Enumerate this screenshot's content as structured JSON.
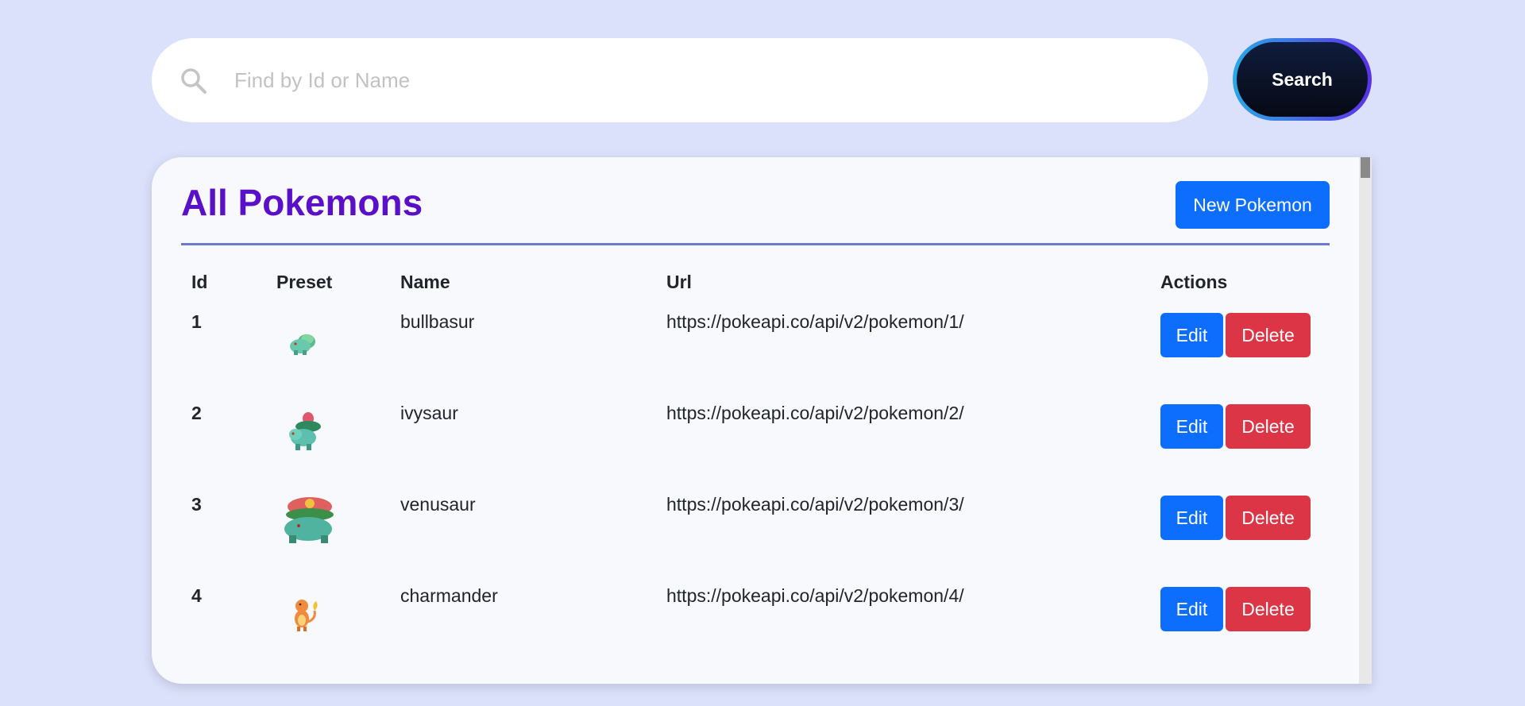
{
  "search": {
    "placeholder": "Find by Id or Name",
    "button_label": "Search",
    "icon": "search-icon"
  },
  "card": {
    "title": "All Pokemons",
    "new_button_label": "New Pokemon"
  },
  "table": {
    "headers": [
      "Id",
      "Preset",
      "Name",
      "Url",
      "Actions"
    ],
    "rows": [
      {
        "id": "1",
        "preset": "bulbasaur-sprite",
        "name": "bullbasur",
        "url": "https://pokeapi.co/api/v2/pokemon/1/",
        "edit": "Edit",
        "delete": "Delete"
      },
      {
        "id": "2",
        "preset": "ivysaur-sprite",
        "name": "ivysaur",
        "url": "https://pokeapi.co/api/v2/pokemon/2/",
        "edit": "Edit",
        "delete": "Delete"
      },
      {
        "id": "3",
        "preset": "venusaur-sprite",
        "name": "venusaur",
        "url": "https://pokeapi.co/api/v2/pokemon/3/",
        "edit": "Edit",
        "delete": "Delete"
      },
      {
        "id": "4",
        "preset": "charmander-sprite",
        "name": "charmander",
        "url": "https://pokeapi.co/api/v2/pokemon/4/",
        "edit": "Edit",
        "delete": "Delete"
      }
    ]
  },
  "colors": {
    "background": "#dce1fb",
    "title": "#5a0fc8",
    "primary": "#0d6efd",
    "danger": "#dc3545"
  }
}
